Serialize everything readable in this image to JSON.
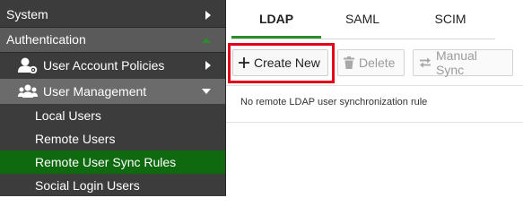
{
  "sidebar": {
    "system_label": "System",
    "authentication_label": "Authentication",
    "groups": [
      {
        "label": "User Account Policies",
        "icon": "user-settings-icon"
      },
      {
        "label": "User Management",
        "icon": "users-icon"
      }
    ],
    "user_management_items": [
      {
        "label": "Local Users"
      },
      {
        "label": "Remote Users"
      },
      {
        "label": "Remote User Sync Rules"
      },
      {
        "label": "Social Login Users"
      }
    ],
    "selected_color": "#0f6a0f"
  },
  "tabs": [
    {
      "label": "LDAP"
    },
    {
      "label": "SAML"
    },
    {
      "label": "SCIM"
    }
  ],
  "toolbar": {
    "create_label": "Create New",
    "delete_label": "Delete",
    "sync_label": "Manual Sync"
  },
  "empty_message": "No remote LDAP user synchronization rule",
  "highlight_color": "#e3001b"
}
